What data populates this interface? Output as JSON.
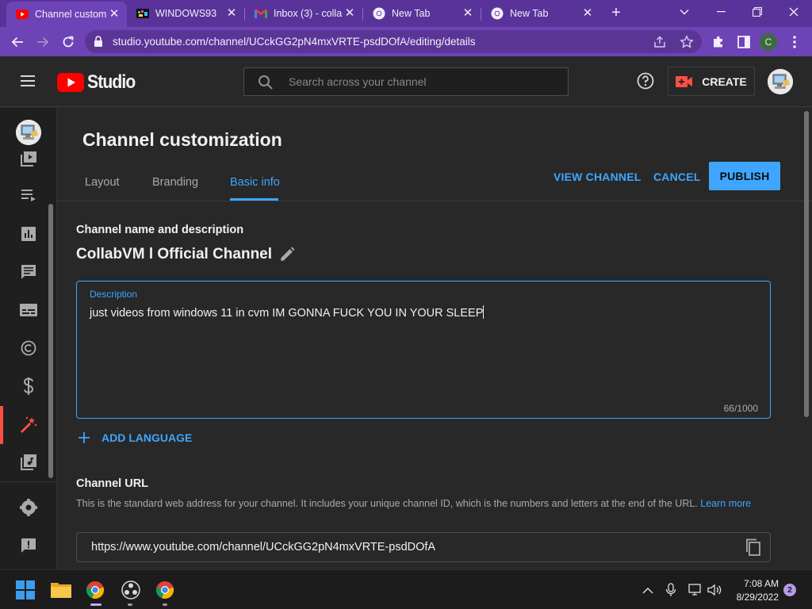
{
  "browser": {
    "tabs": [
      {
        "title": "Channel custom",
        "icon": "youtube-icon",
        "active": true
      },
      {
        "title": "WINDOWS93",
        "icon": "windows93-icon",
        "active": false
      },
      {
        "title": "Inbox (3) - colla",
        "icon": "gmail-icon",
        "active": false
      },
      {
        "title": "New Tab",
        "icon": "chrome-icon",
        "active": false
      },
      {
        "title": "New Tab",
        "icon": "chrome-icon",
        "active": false
      }
    ],
    "url": "studio.youtube.com/channel/UCckGG2pN4mxVRTE-psdDOfA/editing/details",
    "profile_initial": "C",
    "colors": {
      "frame": "#59339a",
      "active_tab": "#6e43b6"
    }
  },
  "header": {
    "logo_text": "Studio",
    "search_placeholder": "Search across your channel",
    "create_label": "CREATE"
  },
  "sidebar": {
    "items": [
      {
        "icon": "content-icon"
      },
      {
        "icon": "playlists-icon"
      },
      {
        "icon": "analytics-icon"
      },
      {
        "icon": "comments-icon"
      },
      {
        "icon": "subtitles-icon"
      },
      {
        "icon": "copyright-icon"
      },
      {
        "icon": "earn-icon"
      },
      {
        "icon": "customization-icon",
        "active": true
      },
      {
        "icon": "audio-library-icon"
      },
      {
        "icon": "settings-icon"
      },
      {
        "icon": "feedback-icon"
      }
    ]
  },
  "main": {
    "page_title": "Channel customization",
    "tabs": [
      {
        "label": "Layout"
      },
      {
        "label": "Branding"
      },
      {
        "label": "Basic info",
        "active": true
      }
    ],
    "actions": {
      "view_channel": "VIEW CHANNEL",
      "cancel": "CANCEL",
      "publish": "PUBLISH"
    },
    "name_section": {
      "heading": "Channel name and description",
      "channel_name": "CollabVM l Official Channel"
    },
    "description": {
      "label": "Description",
      "value": "just videos from windows 11 in cvm IM GONNA FUCK YOU IN YOUR SLEEP",
      "count": "66/1000"
    },
    "add_language": "ADD LANGUAGE",
    "url_section": {
      "heading": "Channel URL",
      "help": "This is the standard web address for your channel. It includes your unique channel ID, which is the numbers and letters at the end of the URL.",
      "learn_more": "Learn more",
      "value": "https://www.youtube.com/channel/UCckGG2pN4mxVRTE-psdDOfA"
    },
    "colors": {
      "accent": "#3ea6ff",
      "active_nav": "#ff4e45"
    }
  },
  "taskbar": {
    "time": "7:08 AM",
    "date": "8/29/2022",
    "notification_count": "2"
  }
}
